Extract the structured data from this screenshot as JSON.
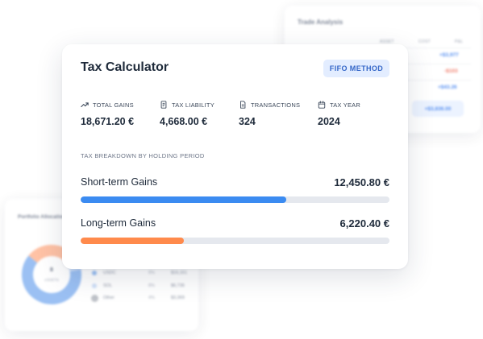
{
  "calculator": {
    "title": "Tax Calculator",
    "method_badge": "FIFO METHOD",
    "stats": [
      {
        "icon": "trending-up-icon",
        "label": "TOTAL GAINS",
        "value": "18,671.20 €"
      },
      {
        "icon": "receipt-icon",
        "label": "TAX LIABILITY",
        "value": "4,668.00 €"
      },
      {
        "icon": "document-icon",
        "label": "TRANSACTIONS",
        "value": "324"
      },
      {
        "icon": "calendar-icon",
        "label": "TAX YEAR",
        "value": "2024"
      }
    ],
    "breakdown_label": "TAX BREAKDOWN BY HOLDING PERIOD",
    "breakdown": [
      {
        "label": "Short-term Gains",
        "value": "12,450.80 €",
        "fraction": 0.667,
        "color": "#3b8bf1"
      },
      {
        "label": "Long-term Gains",
        "value": "6,220.40 €",
        "fraction": 0.333,
        "color": "#ff8a4c"
      }
    ]
  },
  "trade_card": {
    "title": "Trade Analysis",
    "headers": [
      "ASSET",
      "COST",
      "P&L"
    ],
    "values": [
      "+$3,977",
      "-$103",
      "+$43.26"
    ],
    "button_label": "+$3,836.00"
  },
  "portfolio_card": {
    "title": "Portfolio Allocation",
    "center_value": "8",
    "center_label": "ASSETS",
    "legend": [
      {
        "name": "USDC",
        "pct": "9%",
        "amount": "$16,161",
        "color": "#8ab6f2"
      },
      {
        "name": "SOL",
        "pct": "8%",
        "amount": "$6,736",
        "color": "#c7dcf8"
      },
      {
        "name": "Other",
        "pct": "4%",
        "amount": "$3,369",
        "color": "#b4b8c0"
      }
    ]
  },
  "colors": {
    "accent_blue": "#3b8bf1",
    "accent_orange": "#ff8a4c",
    "badge_bg": "#e3edff",
    "badge_text": "#3567c8"
  }
}
